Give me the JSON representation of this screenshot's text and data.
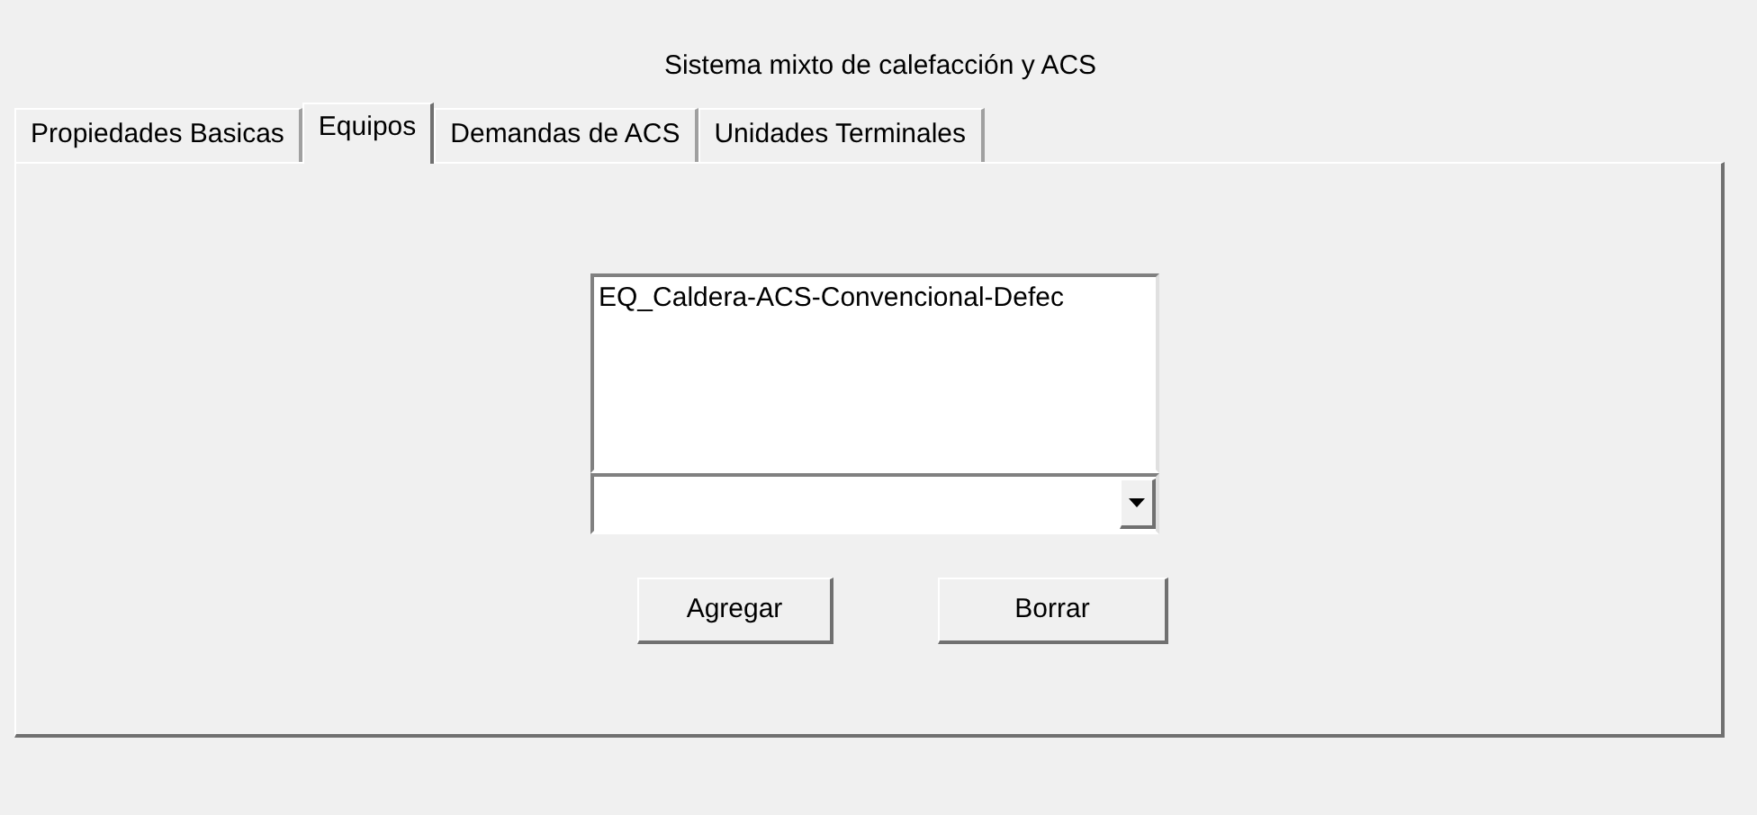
{
  "title": "Sistema mixto de calefacción y ACS",
  "tabs": [
    {
      "label": "Propiedades Basicas",
      "selected": false
    },
    {
      "label": "Equipos",
      "selected": true
    },
    {
      "label": "Demandas de ACS",
      "selected": false
    },
    {
      "label": "Unidades Terminales",
      "selected": false
    }
  ],
  "equipment_list": {
    "items": [
      {
        "label": "EQ_Caldera-ACS-Convencional-Defec",
        "selected": false
      }
    ]
  },
  "buttons": [
    "Agregar",
    "Borrar"
  ]
}
